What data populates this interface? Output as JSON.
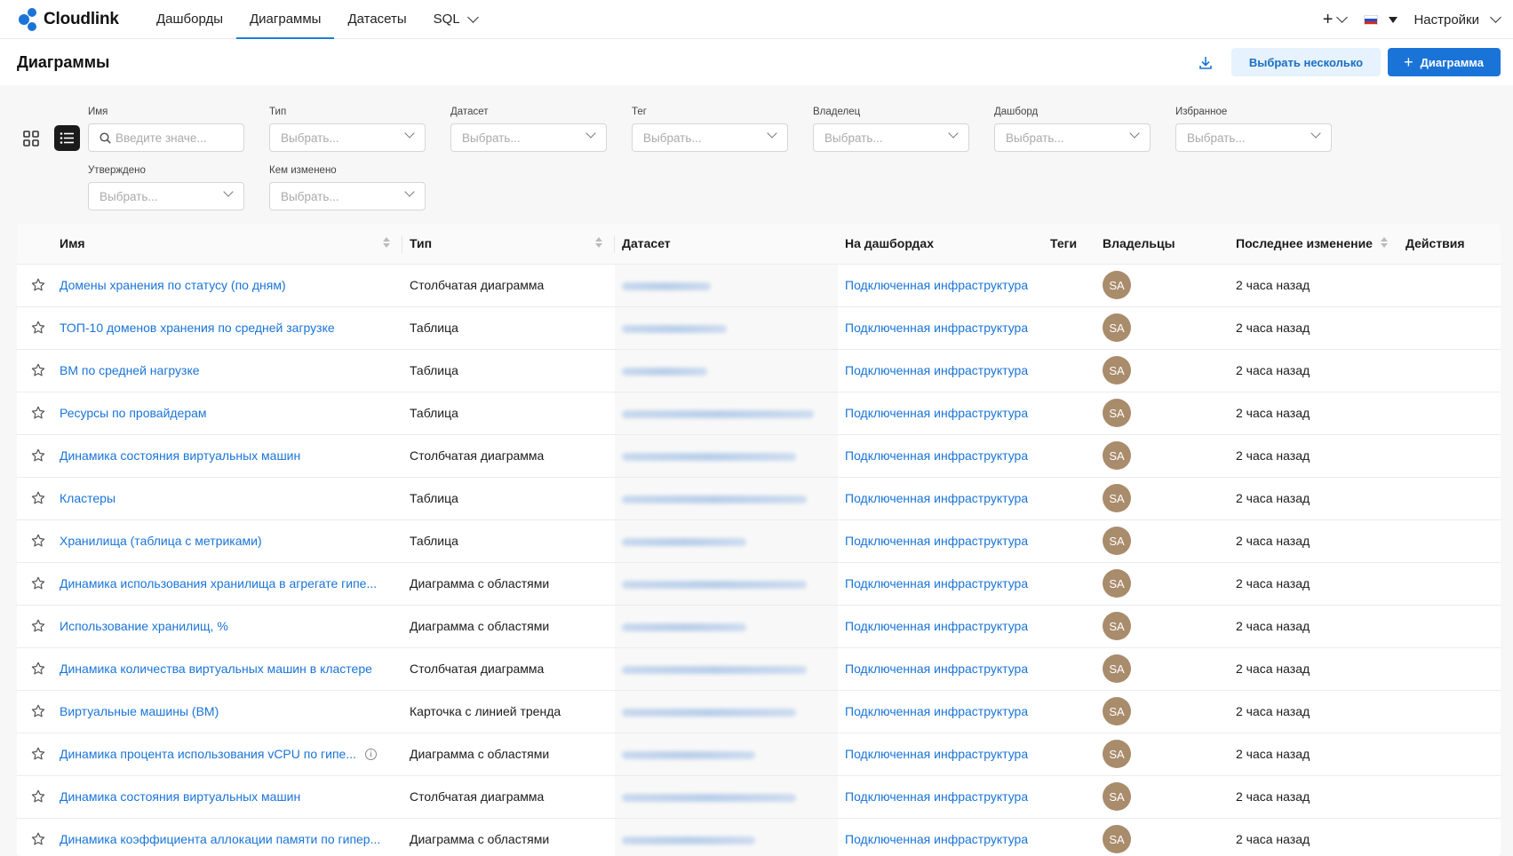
{
  "app": {
    "brand": "Cloudlink",
    "accent": "#1a74d8"
  },
  "nav": {
    "items": [
      {
        "label": "Дашборды",
        "active": false
      },
      {
        "label": "Диаграммы",
        "active": true
      },
      {
        "label": "Датасеты",
        "active": false
      },
      {
        "label": "SQL",
        "active": false
      }
    ],
    "settings_label": "Настройки"
  },
  "page": {
    "title": "Диаграммы",
    "select_multiple_label": "Выбрать несколько",
    "new_chart_label": "Диаграмма"
  },
  "filters": {
    "name": {
      "label": "Имя",
      "placeholder": "Введите значе..."
    },
    "type": {
      "label": "Тип",
      "placeholder": "Выбрать..."
    },
    "dataset": {
      "label": "Датасет",
      "placeholder": "Выбрать..."
    },
    "tag": {
      "label": "Тег",
      "placeholder": "Выбрать..."
    },
    "owner": {
      "label": "Владелец",
      "placeholder": "Выбрать..."
    },
    "dashboard": {
      "label": "Дашборд",
      "placeholder": "Выбрать..."
    },
    "favorite": {
      "label": "Избранное",
      "placeholder": "Выбрать..."
    },
    "certified": {
      "label": "Утверждено",
      "placeholder": "Выбрать..."
    },
    "modified_by": {
      "label": "Кем изменено",
      "placeholder": "Выбрать..."
    }
  },
  "table": {
    "columns": {
      "name": "Имя",
      "type": "Тип",
      "dataset": "Датасет",
      "dashboards": "На дашбордах",
      "tags": "Теги",
      "owners": "Владельцы",
      "modified": "Последнее изменение",
      "actions": "Действия"
    },
    "rows": [
      {
        "name": "Домены хранения по статусу (по дням)",
        "type": "Столбчатая диаграмма",
        "dashboard": "Подключенная инфраструктура",
        "owner": "SA",
        "modified": "2 часа назад"
      },
      {
        "name": "ТОП-10 доменов хранения по средней загрузке",
        "type": "Таблица",
        "dashboard": "Подключенная инфраструктура",
        "owner": "SA",
        "modified": "2 часа назад"
      },
      {
        "name": "ВМ по средней нагрузке",
        "type": "Таблица",
        "dashboard": "Подключенная инфраструктура",
        "owner": "SA",
        "modified": "2 часа назад"
      },
      {
        "name": "Ресурсы по провайдерам",
        "type": "Таблица",
        "dashboard": "Подключенная инфраструктура",
        "owner": "SA",
        "modified": "2 часа назад"
      },
      {
        "name": "Динамика состояния виртуальных машин",
        "type": "Столбчатая диаграмма",
        "dashboard": "Подключенная инфраструктура",
        "owner": "SA",
        "modified": "2 часа назад"
      },
      {
        "name": "Кластеры",
        "type": "Таблица",
        "dashboard": "Подключенная инфраструктура",
        "owner": "SA",
        "modified": "2 часа назад"
      },
      {
        "name": "Хранилища (таблица с метриками)",
        "type": "Таблица",
        "dashboard": "Подключенная инфраструктура",
        "owner": "SA",
        "modified": "2 часа назад"
      },
      {
        "name": "Динамика использования хранилища в агрегате гипе...",
        "type": "Диаграмма с областями",
        "dashboard": "Подключенная инфраструктура",
        "owner": "SA",
        "modified": "2 часа назад"
      },
      {
        "name": "Использование хранилищ, %",
        "type": "Диаграмма с областями",
        "dashboard": "Подключенная инфраструктура",
        "owner": "SA",
        "modified": "2 часа назад"
      },
      {
        "name": "Динамика количества виртуальных машин в кластере",
        "type": "Столбчатая диаграмма",
        "dashboard": "Подключенная инфраструктура",
        "owner": "SA",
        "modified": "2 часа назад"
      },
      {
        "name": "Виртуальные машины (ВМ)",
        "type": "Карточка с линией тренда",
        "dashboard": "Подключенная инфраструктура",
        "owner": "SA",
        "modified": "2 часа назад"
      },
      {
        "name": "Динамика процента использования vCPU по гипе...",
        "type": "Диаграмма с областями",
        "dashboard": "Подключенная инфраструктура",
        "owner": "SA",
        "modified": "2 часа назад",
        "info": true
      },
      {
        "name": "Динамика состояния виртуальных машин",
        "type": "Столбчатая диаграмма",
        "dashboard": "Подключенная инфраструктура",
        "owner": "SA",
        "modified": "2 часа назад"
      },
      {
        "name": "Динамика коэффициента аллокации памяти по гипер...",
        "type": "Диаграмма с областями",
        "dashboard": "Подключенная инфраструктура",
        "owner": "SA",
        "modified": "2 часа назад"
      }
    ]
  }
}
